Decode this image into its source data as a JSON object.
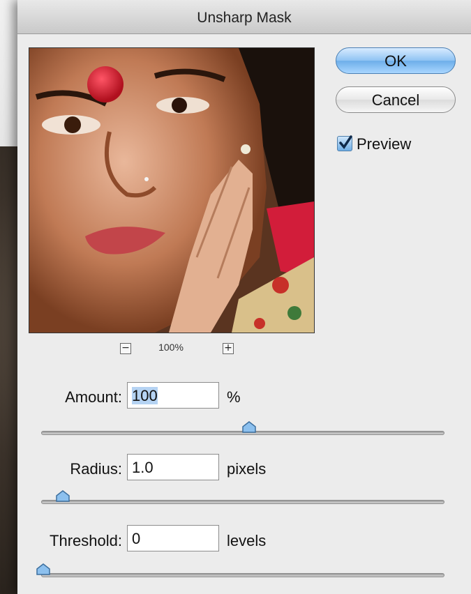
{
  "dialog": {
    "title": "Unsharp Mask"
  },
  "preview_image": {
    "description_icon": "portrait-photo",
    "zoom_level": "100%",
    "zoom_out_symbol": "−",
    "zoom_in_symbol": "+"
  },
  "buttons": {
    "ok": "OK",
    "cancel": "Cancel"
  },
  "preview_option": {
    "label": "Preview",
    "checked": true
  },
  "controls": {
    "amount": {
      "label": "Amount:",
      "value": "100",
      "unit": "%",
      "slider_fraction": 0.53
    },
    "radius": {
      "label": "Radius:",
      "value": "1.0",
      "unit": "pixels",
      "slider_fraction": 0.05
    },
    "threshold": {
      "label": "Threshold:",
      "value": "0",
      "unit": "levels",
      "slider_fraction": 0.0
    }
  },
  "colors": {
    "dialog_background": "#ececec",
    "accent_blue": "#6daee9",
    "bindi_red": "#d01c2c"
  }
}
